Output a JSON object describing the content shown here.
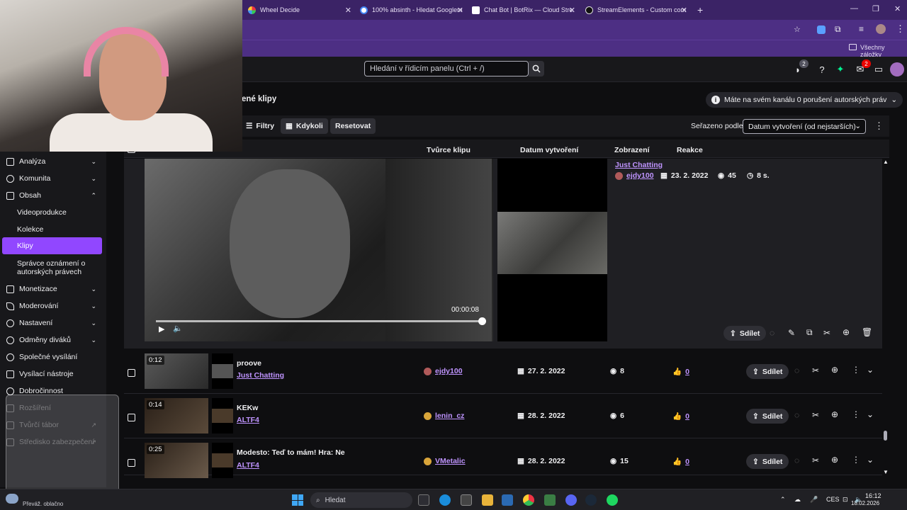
{
  "browser": {
    "tabs": [
      {
        "title": "Wheel Decide"
      },
      {
        "title": "100% absinth - Hledat Googlem"
      },
      {
        "title": "Chat Bot | BotRix — Cloud Stre"
      },
      {
        "title": "StreamElements - Custom com"
      }
    ],
    "new_tab": "+",
    "bookmarks_label": "Všechny záložky"
  },
  "topnav": {
    "search_placeholder": "Hledání v řídicím panelu (Ctrl + /)",
    "notif_count_1": "2",
    "notif_count_2": "2"
  },
  "page": {
    "title": "ené klipy",
    "copyright_notice": "Máte na svém kanálu 0 porušení autorských práv"
  },
  "toolbar": {
    "filters": "Filtry",
    "anytime": "Kdykoli",
    "reset": "Resetovat",
    "sort_label": "Seřazeno podle",
    "sort_value": "Datum vytvoření (od nejstarších)"
  },
  "columns": {
    "creator": "Tvůrce klipu",
    "date": "Datum vytvoření",
    "views": "Zobrazení",
    "reactions": "Reakce"
  },
  "sidebar": {
    "items": [
      {
        "label": "Analýza"
      },
      {
        "label": "Komunita"
      },
      {
        "label": "Obsah"
      },
      {
        "label": "Monetizace"
      },
      {
        "label": "Moderování"
      },
      {
        "label": "Nastavení"
      },
      {
        "label": "Odměny diváků"
      },
      {
        "label": "Společné vysílání"
      },
      {
        "label": "Vysílací nástroje"
      },
      {
        "label": "Dobročinnost"
      },
      {
        "label": "Rozšíření"
      },
      {
        "label": "Tvůrčí tábor"
      },
      {
        "label": "Středisko zabezpečení"
      }
    ],
    "sub": {
      "video": "Videoprodukce",
      "collections": "Kolekce",
      "clips": "Klipy",
      "copyright_line1": "Správce oznámení o",
      "copyright_line2": "autorských právech"
    }
  },
  "expanded_clip": {
    "category": "Just Chatting",
    "creator": "ejdy100",
    "date": "23. 2. 2022",
    "views": "45",
    "duration": "8 s.",
    "timecode": "00:00:08",
    "share": "Sdílet"
  },
  "clips": [
    {
      "duration": "0:12",
      "title": "proove",
      "category": "Just Chatting",
      "creator": "ejdy100",
      "date": "27. 2. 2022",
      "views": "8",
      "reactions": "0",
      "share": "Sdílet"
    },
    {
      "duration": "0:14",
      "title": "KEKw",
      "category": "ALTF4",
      "creator": "lenin_cz",
      "date": "28. 2. 2022",
      "views": "6",
      "reactions": "0",
      "share": "Sdílet"
    },
    {
      "duration": "0:25",
      "title": "Modesto: Teď to mám! Hra: Ne",
      "category": "ALTF4",
      "creator": "VMetalic",
      "date": "28. 2. 2022",
      "views": "15",
      "reactions": "0",
      "share": "Sdílet"
    }
  ],
  "taskbar": {
    "search": "Hledat",
    "weather": "Převáž. oblačno",
    "lang": "CES",
    "time": "16:12",
    "date": "18.02.2026"
  },
  "colors": {
    "accent": "#9147ff",
    "link": "#bf94ff",
    "browser": "#4d2f84"
  }
}
